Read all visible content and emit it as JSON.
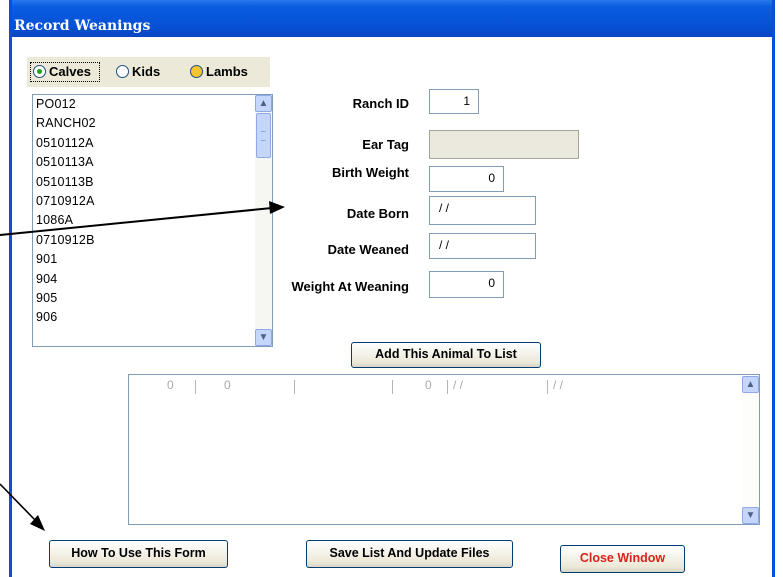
{
  "window": {
    "title": "Record Weanings"
  },
  "animal_type": {
    "options": [
      "Calves",
      "Kids",
      "Lambs"
    ],
    "selected": "Calves"
  },
  "animal_list": {
    "items": [
      "PO012",
      "RANCH02",
      "0510112A",
      "0510113A",
      "0510113B",
      "0710912A",
      "1086A",
      "0710912B",
      "901",
      "904",
      "905",
      "906"
    ]
  },
  "form": {
    "ranch_id": {
      "label": "Ranch ID",
      "value": "1"
    },
    "ear_tag": {
      "label": "Ear Tag",
      "value": ""
    },
    "birth_weight": {
      "label": "Birth Weight",
      "value": "0"
    },
    "date_born": {
      "label": "Date Born",
      "value": "/ /"
    },
    "date_weaned": {
      "label": "Date Weaned",
      "value": "/ /"
    },
    "weight_at_weaning": {
      "label": "Weight At Weaning",
      "value": "0"
    }
  },
  "buttons": {
    "add": "Add This Animal To List",
    "how_to": "How To Use This Form",
    "save": "Save List And Update Files",
    "close": "Close Window"
  },
  "records_grid": {
    "rows": [
      [
        "0",
        "0",
        "",
        "0",
        "/ /",
        "/ /"
      ]
    ]
  },
  "colors": {
    "titlebar": "#0751d6",
    "button_border": "#003c74",
    "close_text": "#d9231c",
    "radio_group_bg": "#ece9d8"
  },
  "icons": [
    "scroll-up-icon",
    "scroll-down-icon",
    "radio-checked-icon",
    "radio-empty-icon",
    "radio-yellow-icon",
    "annotation-arrow-icon"
  ]
}
